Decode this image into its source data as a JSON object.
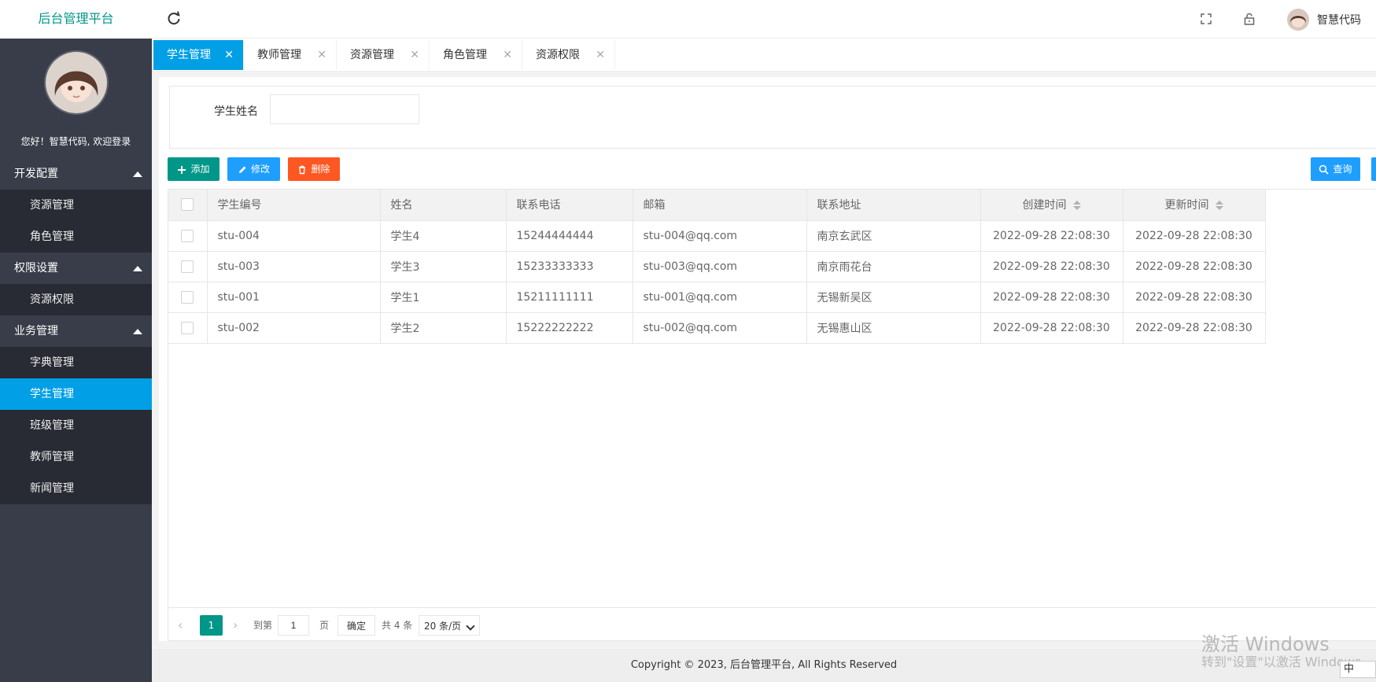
{
  "header": {
    "logo": "后台管理平台",
    "user_name": "智慧代码"
  },
  "sidebar": {
    "welcome": "您好！智慧代码, 欢迎登录",
    "groups": [
      {
        "title": "开发配置",
        "items": [
          "资源管理",
          "角色管理"
        ]
      },
      {
        "title": "权限设置",
        "items": [
          "资源权限"
        ]
      },
      {
        "title": "业务管理",
        "items": [
          "字典管理",
          "学生管理",
          "班级管理",
          "教师管理",
          "新闻管理"
        ]
      }
    ],
    "active_item": "学生管理"
  },
  "tabs": [
    "学生管理",
    "教师管理",
    "资源管理",
    "角色管理",
    "资源权限"
  ],
  "search": {
    "label": "学生姓名",
    "value": "",
    "placeholder": ""
  },
  "toolbar": {
    "add_label": "添加",
    "edit_label": "修改",
    "delete_label": "删除",
    "query_label": "查询"
  },
  "table": {
    "headers": [
      "学生编号",
      "姓名",
      "联系电话",
      "邮箱",
      "联系地址",
      "创建时间",
      "更新时间"
    ],
    "rows": [
      [
        "stu-004",
        "学生4",
        "15244444444",
        "stu-004@qq.com",
        "南京玄武区",
        "2022-09-28 22:08:30",
        "2022-09-28 22:08:30"
      ],
      [
        "stu-003",
        "学生3",
        "15233333333",
        "stu-003@qq.com",
        "南京雨花台",
        "2022-09-28 22:08:30",
        "2022-09-28 22:08:30"
      ],
      [
        "stu-001",
        "学生1",
        "15211111111",
        "stu-001@qq.com",
        "无锡新吴区",
        "2022-09-28 22:08:30",
        "2022-09-28 22:08:30"
      ],
      [
        "stu-002",
        "学生2",
        "15222222222",
        "stu-002@qq.com",
        "无锡惠山区",
        "2022-09-28 22:08:30",
        "2022-09-28 22:08:30"
      ]
    ]
  },
  "pager": {
    "current": "1",
    "goto_label": "到第",
    "goto_value": "1",
    "page_unit": "页",
    "ok_label": "确定",
    "total": "共 4 条",
    "page_size": "20 条/页"
  },
  "footer": "Copyright © 2023, 后台管理平台, All Rights Reserved",
  "watermark": {
    "line1": "激活 Windows",
    "line2": "转到\"设置\"以激活 Windows。"
  },
  "ime": "中"
}
